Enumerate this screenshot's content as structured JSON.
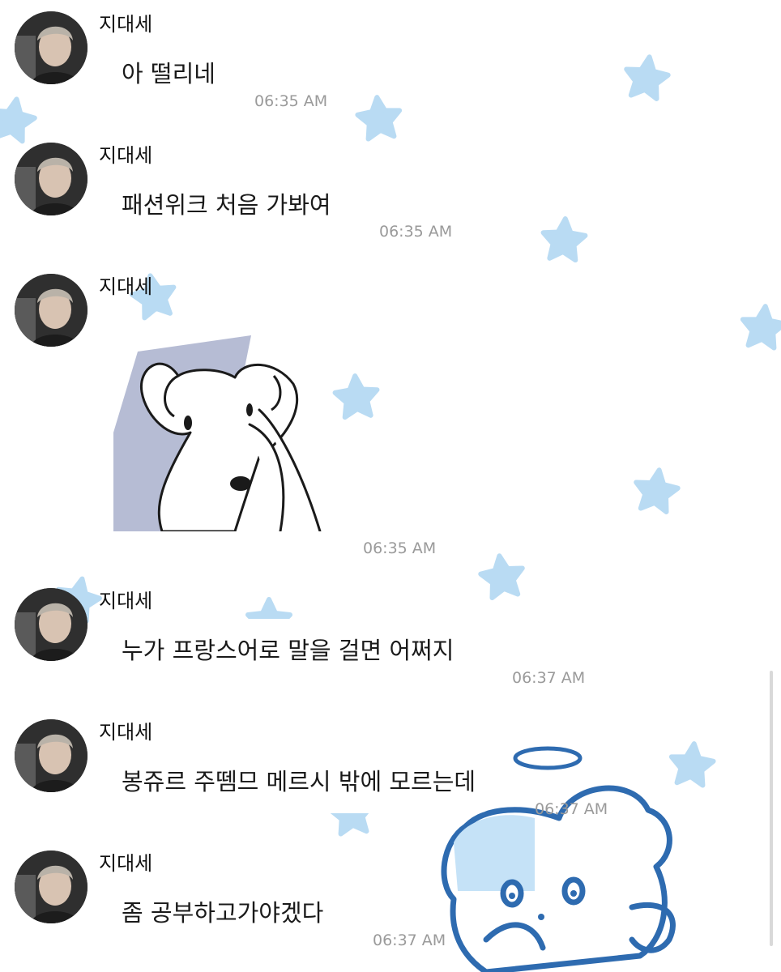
{
  "sender_name": "지대세",
  "messages": [
    {
      "type": "text",
      "text": "아 떨리네",
      "time": "06:35 AM"
    },
    {
      "type": "text",
      "text": "패션위크 처음 가봐여",
      "time": "06:35 AM"
    },
    {
      "type": "sticker",
      "sticker": "bear-sticker",
      "time": "06:35 AM"
    },
    {
      "type": "text",
      "text": "누가 프랑스어로 말을 걸면 어쩌지",
      "time": "06:37 AM"
    },
    {
      "type": "text",
      "text": "봉쥬르 주뗌므 메르시 밖에 모르는데",
      "time": "06:37 AM"
    },
    {
      "type": "text",
      "text": "좀 공부하고가야겠다",
      "time": "06:37 AM"
    }
  ],
  "colors": {
    "star": "#b9dbf3",
    "angel_bear_outline": "#2e6bb0",
    "timestamp": "#9a9a9a"
  }
}
